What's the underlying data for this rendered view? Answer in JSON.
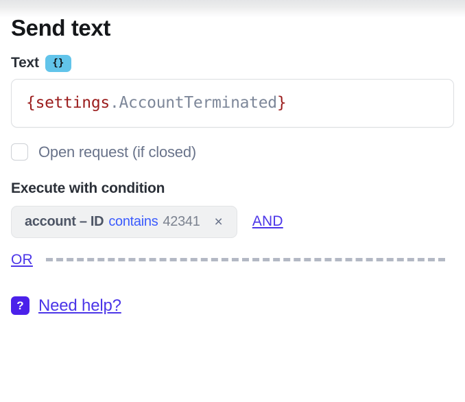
{
  "header": {
    "title": "Send text"
  },
  "text_field": {
    "label": "Text",
    "template_badge": "{}",
    "value_parts": {
      "open_brace": "{",
      "root": "settings",
      "property": ".AccountTerminated",
      "close_brace": "}"
    },
    "value": "{settings.AccountTerminated}"
  },
  "open_request": {
    "label": "Open request (if closed)",
    "checked": false
  },
  "condition_section": {
    "heading": "Execute with condition",
    "chip": {
      "field": "account – ID",
      "operator": "contains",
      "value": "42341",
      "close_icon": "×"
    },
    "and_label": "AND",
    "or_label": "OR"
  },
  "help": {
    "badge": "?",
    "label": "Need help?"
  },
  "colors": {
    "accent_blue": "#3b5bfd",
    "link_purple": "#4b35e8",
    "help_badge_purple": "#4b21ea",
    "template_badge_blue": "#62c4ea",
    "template_red": "#9b1d1d",
    "template_gray": "#7d8799",
    "muted_text": "#69738a",
    "heading_text": "#2b3038",
    "dashed_rule": "#b3b8c4"
  }
}
